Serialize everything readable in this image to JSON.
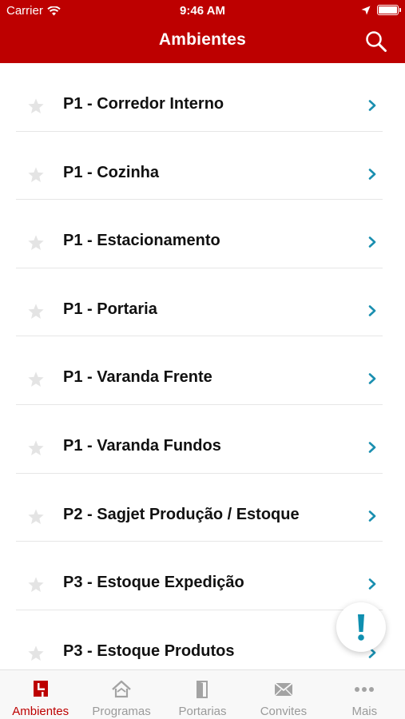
{
  "status_bar": {
    "carrier": "Carrier",
    "time": "9:46 AM"
  },
  "header": {
    "title": "Ambientes"
  },
  "list": {
    "items": [
      {
        "label": "P1 - Corredor Interno"
      },
      {
        "label": "P1 - Cozinha"
      },
      {
        "label": "P1 - Estacionamento"
      },
      {
        "label": "P1 - Portaria"
      },
      {
        "label": "P1 - Varanda Frente"
      },
      {
        "label": "P1 - Varanda Fundos"
      },
      {
        "label": "P2 - Sagjet Produção / Estoque"
      },
      {
        "label": "P3 - Estoque Expedição"
      },
      {
        "label": "P3 - Estoque Produtos"
      }
    ]
  },
  "tabbar": {
    "tabs": [
      {
        "label": "Ambientes",
        "icon": "ambientes-icon",
        "active": true
      },
      {
        "label": "Programas",
        "icon": "house-icon",
        "active": false
      },
      {
        "label": "Portarias",
        "icon": "door-icon",
        "active": false
      },
      {
        "label": "Convites",
        "icon": "envelope-icon",
        "active": false
      },
      {
        "label": "Mais",
        "icon": "more-dots-icon",
        "active": false
      }
    ]
  },
  "colors": {
    "brand": "#bd0000",
    "chevron": "#1a8fb0",
    "fab_icon": "#0f8fb0",
    "inactive_tab": "#9a9a9a"
  }
}
